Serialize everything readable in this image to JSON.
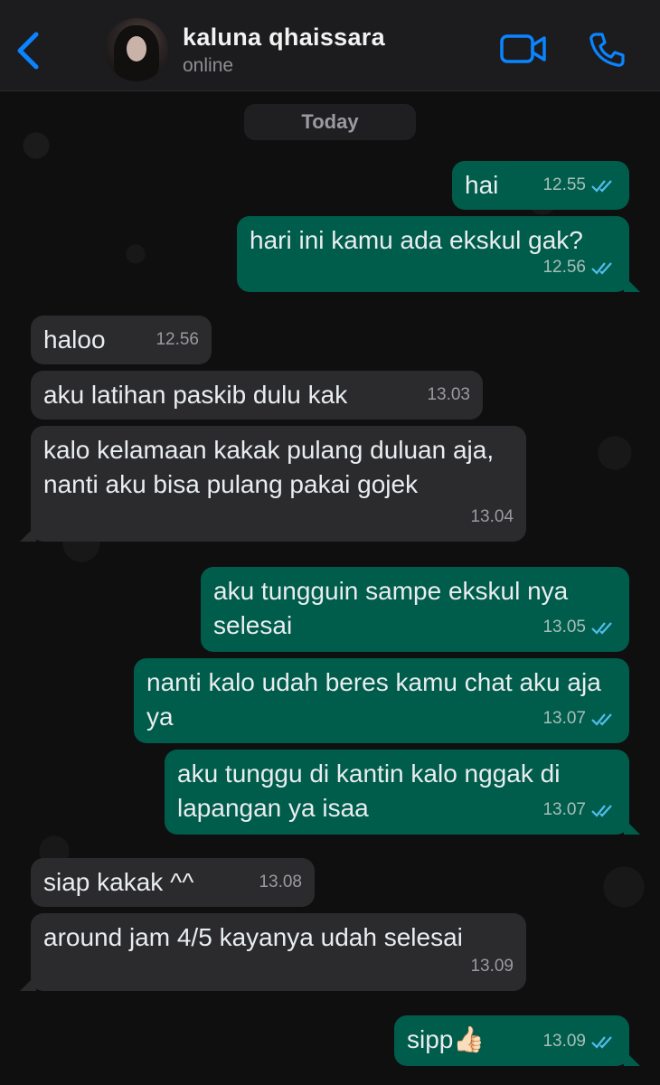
{
  "header": {
    "contact_name": "kaluna qhaissara",
    "status": "online",
    "accent_color": "#0a84ff"
  },
  "chat": {
    "date_label": "Today",
    "messages": [
      {
        "dir": "out",
        "text": "hai",
        "time": "12.55",
        "read": true
      },
      {
        "dir": "out",
        "text": "hari ini kamu ada ekskul gak?",
        "time": "12.56",
        "read": true
      },
      {
        "dir": "in",
        "text": "haloo",
        "time": "12.56"
      },
      {
        "dir": "in",
        "text": "aku latihan paskib dulu kak",
        "time": "13.03"
      },
      {
        "dir": "in",
        "text": "kalo kelamaan kakak pulang duluan aja, nanti aku bisa pulang pakai gojek",
        "time": "13.04"
      },
      {
        "dir": "out",
        "text": "aku tungguin sampe ekskul nya selesai",
        "time": "13.05",
        "read": true
      },
      {
        "dir": "out",
        "text": "nanti kalo udah beres kamu chat aku aja ya",
        "time": "13.07",
        "read": true
      },
      {
        "dir": "out",
        "text": "aku tunggu di kantin kalo nggak di lapangan ya isaa",
        "time": "13.07",
        "read": true
      },
      {
        "dir": "in",
        "text": "siap kakak ^^",
        "time": "13.08"
      },
      {
        "dir": "in",
        "text": "around jam 4/5 kayanya udah selesai",
        "time": "13.09"
      },
      {
        "dir": "out",
        "text": "sipp👍🏻",
        "time": "13.09",
        "read": true
      }
    ]
  }
}
